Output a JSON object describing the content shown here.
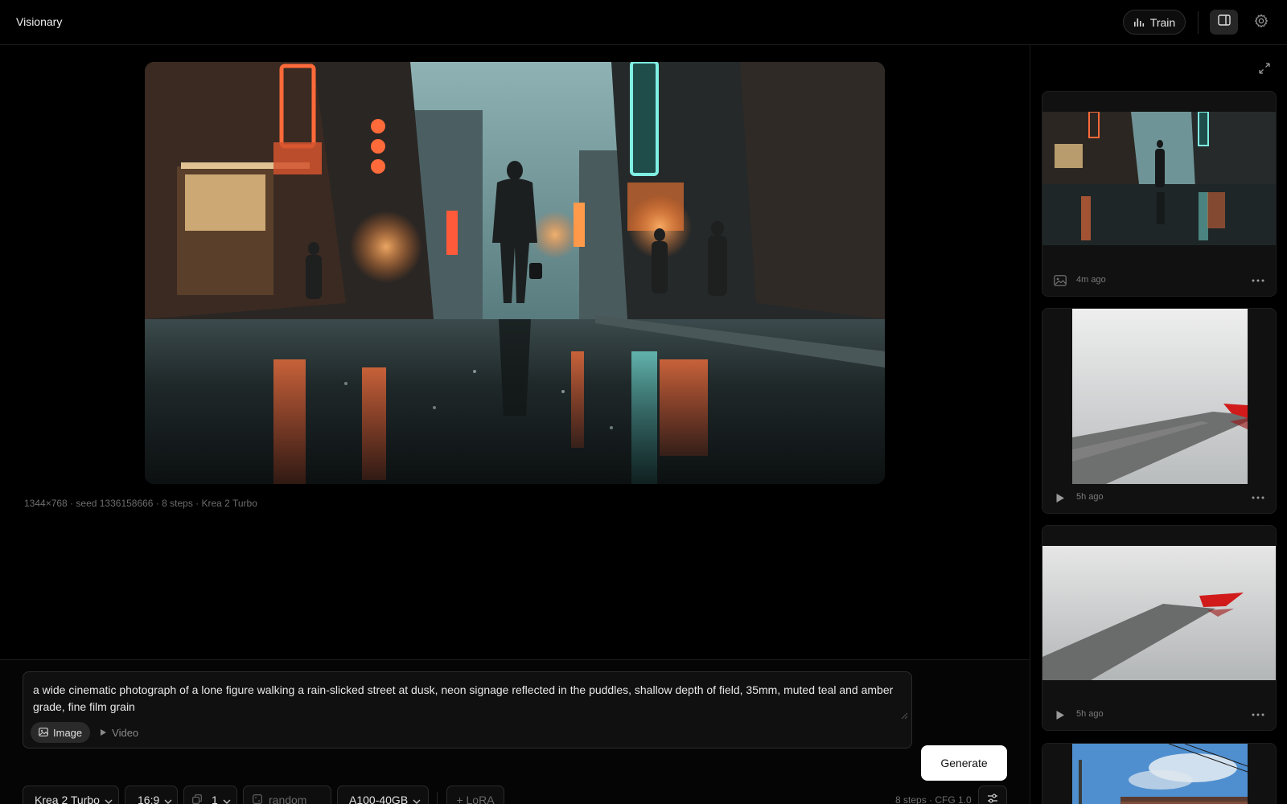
{
  "app": {
    "title": "Visionary"
  },
  "header": {
    "train_label": "Train"
  },
  "main": {
    "hero_meta": "1344×768 · seed 1336158666 · 8 steps · Krea 2 Turbo"
  },
  "composer": {
    "prompt": "a wide cinematic photograph of a lone figure walking a rain-slicked street at dusk, neon signage reflected in the puddles, shallow depth of field, 35mm, muted teal and amber grade, fine film grain",
    "mode_image": "Image",
    "mode_video": "Video",
    "active_mode": "Image",
    "generate_label": "Generate",
    "model": "Krea 2 Turbo",
    "aspect": "16:9",
    "count": "1",
    "seed_placeholder": "random",
    "gpu": "A100-40GB",
    "lora_label": "+ LoRA",
    "steps_info": "8 steps · CFG 1.0"
  },
  "history": [
    {
      "type": "image",
      "time": "4m ago",
      "icon": "image-icon"
    },
    {
      "type": "video",
      "time": "5h ago",
      "icon": "play-icon"
    },
    {
      "type": "video",
      "time": "5h ago",
      "icon": "play-icon"
    },
    {
      "type": "image",
      "time": "",
      "icon": ""
    }
  ],
  "colors": {
    "background": "#000000",
    "panel": "#111111",
    "border": "#2a2a2a",
    "accent_button": "#ffffff",
    "muted_text": "#6d6d6d"
  }
}
